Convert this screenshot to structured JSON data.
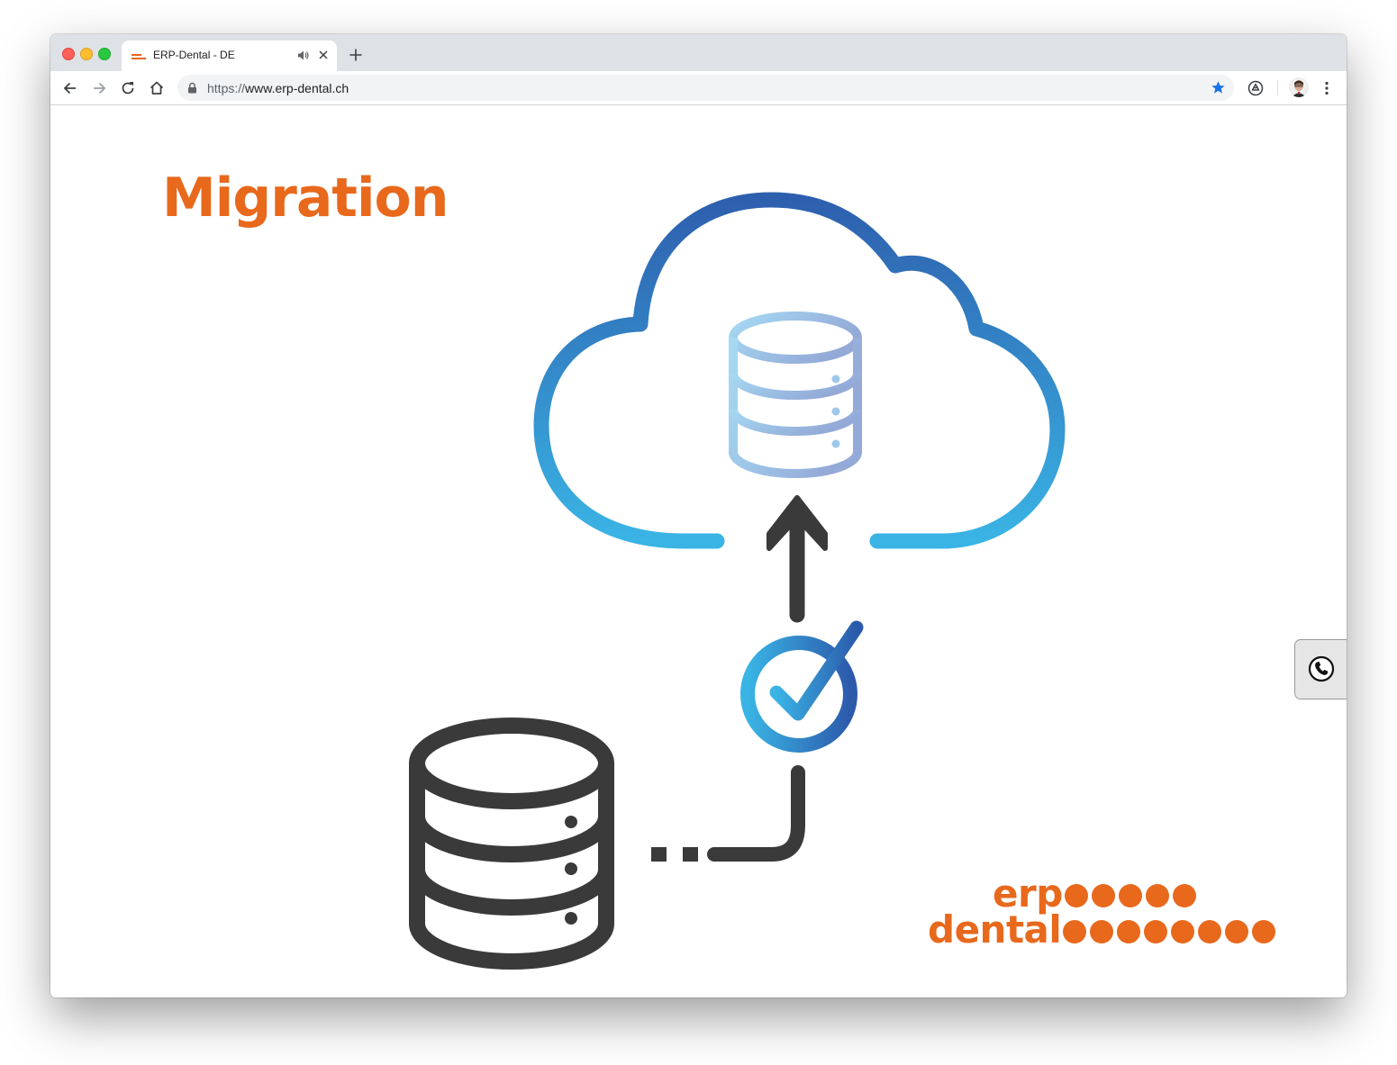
{
  "browser": {
    "tab": {
      "title": "ERP-Dental - DE",
      "favicon": "erp-dental-favicon",
      "audio_icon": "speaker-icon",
      "close_icon": "close-icon"
    },
    "new_tab_icon": "plus-icon",
    "toolbar": {
      "back_icon": "back-arrow-icon",
      "forward_icon": "forward-arrow-icon",
      "reload_icon": "reload-icon",
      "home_icon": "home-icon",
      "lock_icon": "lock-icon",
      "url_scheme": "https://",
      "url_host": "www.erp-dental.ch",
      "bookmark_icon": "star-icon",
      "bookmark_color": "#1a73e8",
      "extension_icon": "shield-extension-icon",
      "profile_icon": "avatar",
      "menu_icon": "kebab-menu-icon"
    }
  },
  "page": {
    "title": "Migration",
    "accent_color": "#e8681c",
    "illustration": {
      "cloud_icon": "cloud-icon",
      "cloud_database_icon": "cloud-database-icon",
      "upload_arrow_icon": "up-arrow-icon",
      "check_icon": "check-circle-icon",
      "local_database_icon": "database-icon",
      "cloud_gradient": [
        "#2e5fae",
        "#3ab4e5"
      ],
      "dark_color": "#3a3a3a"
    },
    "logo": {
      "line1": "erp",
      "line2": "dental",
      "line1_dots": 5,
      "line2_dots": 8
    },
    "call_button_icon": "phone-icon"
  }
}
